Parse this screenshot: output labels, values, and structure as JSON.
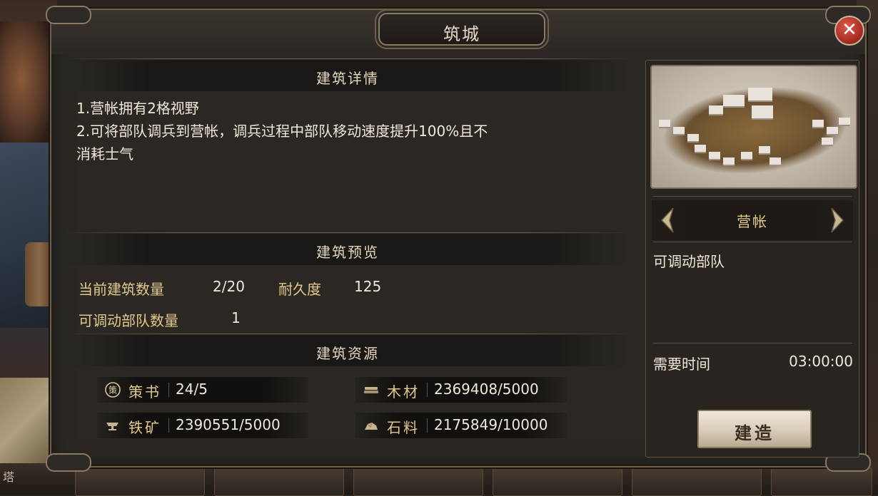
{
  "dialog": {
    "title": "筑城",
    "close_icon": "close-icon"
  },
  "details": {
    "header": "建筑详情",
    "lines": [
      "1.营帐拥有2格视野",
      "2.可将部队调兵到营帐，调兵过程中部队移动速度提升100%且不",
      "消耗士气"
    ]
  },
  "preview": {
    "header": "建筑预览",
    "current_count_label": "当前建筑数量",
    "current_count_value": "2/20",
    "durability_label": "耐久度",
    "durability_value": "125",
    "movable_units_label": "可调动部队数量",
    "movable_units_value": "1"
  },
  "resources": {
    "header": "建筑资源",
    "items": [
      {
        "name": "策书",
        "value": "24/5",
        "icon": "strategy-book-icon"
      },
      {
        "name": "木材",
        "value": "2369408/5000",
        "icon": "wood-icon"
      },
      {
        "name": "铁矿",
        "value": "2390551/5000",
        "icon": "iron-ore-icon"
      },
      {
        "name": "石料",
        "value": "2175849/10000",
        "icon": "stone-icon"
      }
    ]
  },
  "building": {
    "name": "营帐",
    "description": "可调动部队",
    "time_label": "需要时间",
    "time_value": "03:00:00",
    "build_button": "建造",
    "prev_icon": "chevron-left-icon",
    "next_icon": "chevron-right-icon"
  },
  "background": {
    "bottom_left_text": "塔"
  },
  "colors": {
    "gold_text": "#e2c98c",
    "body_text": "#f0e8dc",
    "close_red": "#b0302a"
  }
}
